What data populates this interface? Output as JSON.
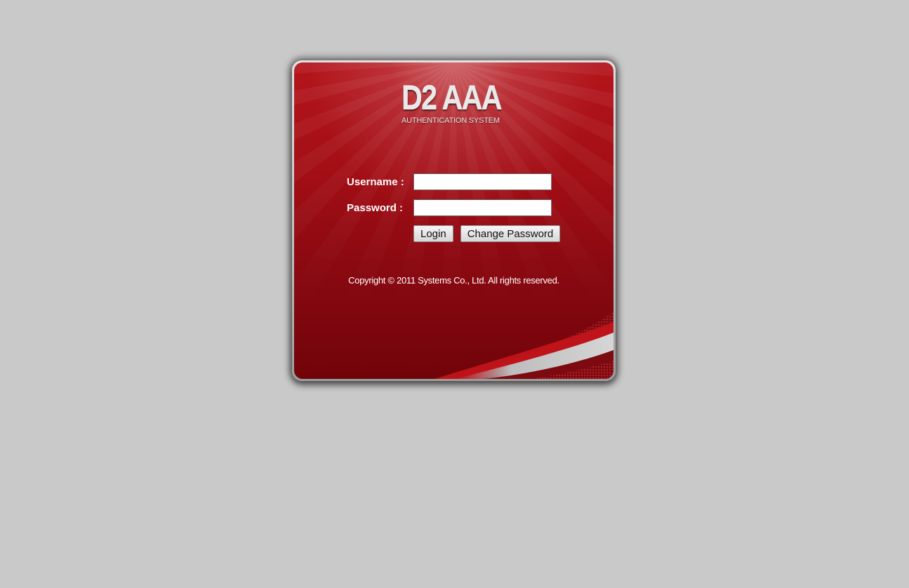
{
  "logo": {
    "title": "D2 AAA",
    "subtitle": "AUTHENTICATION SYSTEM"
  },
  "form": {
    "username_label": "Username :",
    "username_value": "",
    "password_label": "Password :",
    "password_value": "",
    "login_label": "Login",
    "change_password_label": "Change Password"
  },
  "footer": {
    "copyright": "Copyright © 2011 Systems Co., Ltd. All rights reserved."
  },
  "colors": {
    "background": "#c9c9c9",
    "panel_red": "#a30e15",
    "panel_dark_red": "#700409"
  }
}
